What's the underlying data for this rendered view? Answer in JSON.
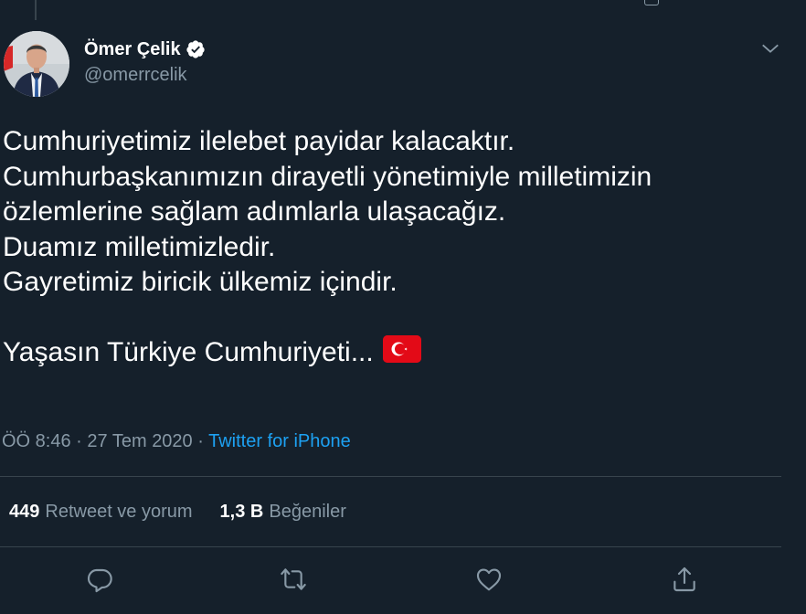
{
  "tweet": {
    "author_name": "Ömer Çelik",
    "author_handle": "@omerrcelik",
    "lines": [
      "Cumhuriyetimiz ilelebet payidar kalacaktır.",
      "Cumhurbaşkanımızın dirayetli yönetimiyle milletimizin",
      "özlemlerine sağlam adımlarla ulaşacağız.",
      "Duamız milletimizledir.",
      "Gayretimiz biricik ülkemiz içindir.",
      "",
      "Yaşasın Türkiye Cumhuriyeti..."
    ],
    "time": "ÖÖ 8:46",
    "date": "27 Tem 2020",
    "separator": "·",
    "source": "Twitter for iPhone"
  },
  "stats": {
    "retweets_count": "449",
    "retweets_label": "Retweet ve yorum",
    "likes_count": "1,3 B",
    "likes_label": "Beğeniler"
  },
  "icons": {
    "verified": "verified-badge-icon",
    "caret": "chevron-down-icon",
    "reply": "reply-icon",
    "retweet": "retweet-icon",
    "like": "heart-icon",
    "share": "share-icon",
    "flag": "turkey-flag-icon"
  },
  "colors": {
    "background": "#15202b",
    "text": "#ffffff",
    "secondary": "#8899a6",
    "accent": "#1da1f2",
    "divider": "#38444d"
  }
}
